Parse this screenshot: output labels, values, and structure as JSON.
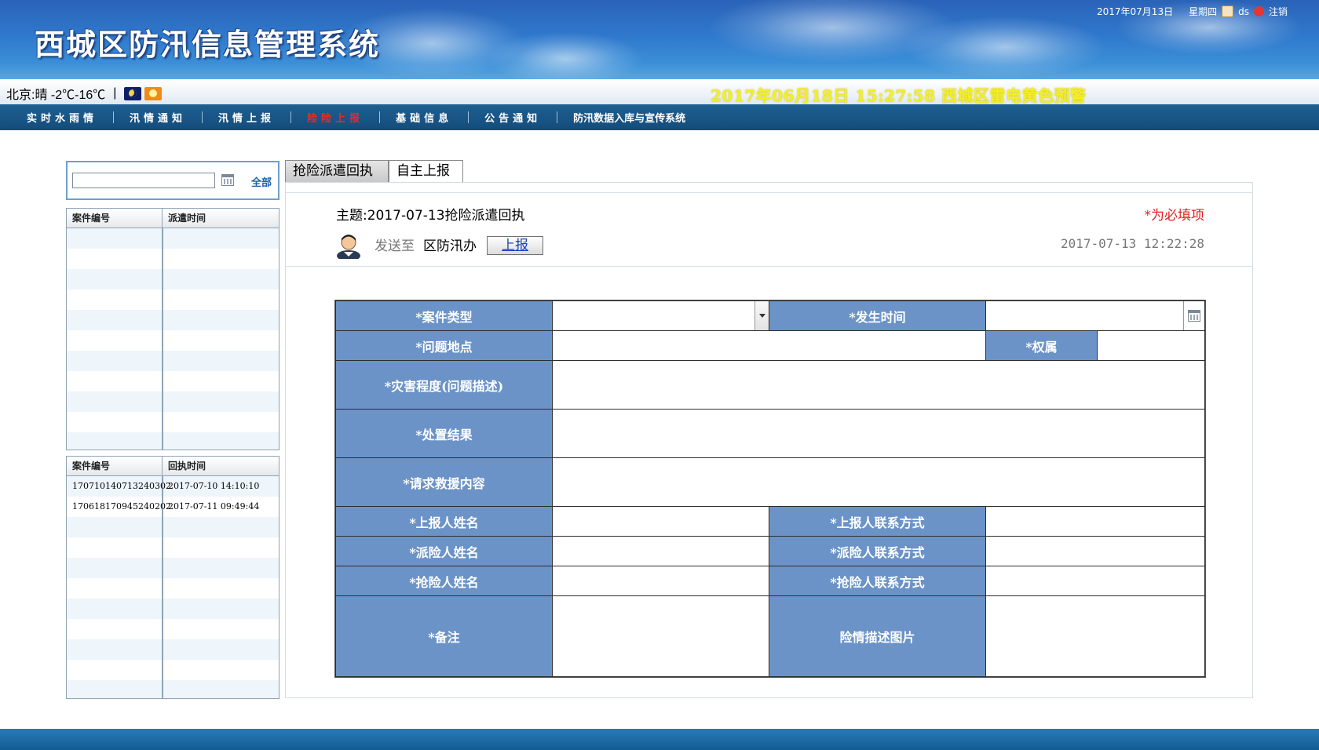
{
  "header": {
    "title": "西城区防汛信息管理系统",
    "date": "2017年07月13日",
    "weekday": "星期四",
    "username": "ds",
    "logout_label": "注销"
  },
  "weather": {
    "text": "北京:晴 -2℃-16℃",
    "separator": "|",
    "icons": [
      "moon-icon",
      "sun-icon"
    ]
  },
  "alert_marquee": "2017年06月18日 15:27:58 西城区雷电黄色预警",
  "nav": {
    "items": [
      {
        "label": "实时水雨情",
        "active": false
      },
      {
        "label": "汛情通知",
        "active": false
      },
      {
        "label": "汛情上报",
        "active": false
      },
      {
        "label": "险险上报",
        "active": true
      },
      {
        "label": "基础信息",
        "active": false
      },
      {
        "label": "公告通知",
        "active": false
      },
      {
        "label": "防汛数据入库与宣传系统",
        "active": false
      }
    ]
  },
  "sidebar": {
    "search_value": "",
    "all_label": "全部",
    "dispatch_table": {
      "headers": [
        "案件编号",
        "派遣时间"
      ],
      "rows": []
    },
    "receipt_table": {
      "headers": [
        "案件编号",
        "回执时间"
      ],
      "rows": [
        [
          "170710140713240302",
          "2017-07-10 14:10:10"
        ],
        [
          "170618170945240202",
          "2017-07-11 09:49:44"
        ]
      ]
    }
  },
  "tabs": [
    {
      "label": "抢险派遣回执",
      "selected": true
    },
    {
      "label": "自主上报",
      "selected": false
    }
  ],
  "info": {
    "subject_label": "主题:",
    "subject": "2017-07-13抢险派遣回执",
    "required_note": "*为必填项",
    "sendto_label": "发送至",
    "sendto_value": "区防汛办",
    "report_button": "上报",
    "timestamp": "2017-07-13 12:22:28"
  },
  "form": {
    "case_type": "*案件类型",
    "occur_time": "*发生时间",
    "location": "*问题地点",
    "ownership": "*权属",
    "damage": "*灾害程度(问题描述)",
    "result": "*处置结果",
    "rescue_request": "*请求救援内容",
    "reporter_name": "*上报人姓名",
    "reporter_contact": "*上报人联系方式",
    "dispatcher_name": "*派险人姓名",
    "dispatcher_contact": "*派险人联系方式",
    "rescuer_name": "*抢险人姓名",
    "rescuer_contact": "*抢险人联系方式",
    "remarks": "*备注",
    "photos": "险情描述图片"
  },
  "colors": {
    "label_bg": "#6b93c7",
    "nav_bg": "#144c7a",
    "alert_text": "#f3f023",
    "active_nav": "#e52b2b",
    "required": "#e02020"
  }
}
